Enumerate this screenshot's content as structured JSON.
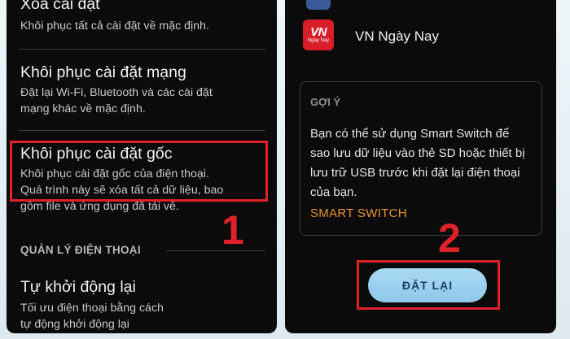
{
  "left_screen": {
    "items": [
      {
        "title": "Xóa cài đặt",
        "desc": "Khôi phục tất cả cài đặt về mặc định."
      },
      {
        "title": "Khôi phục cài đặt mạng",
        "desc_lines": [
          "Đặt lại Wi-Fi, Bluetooth và các cài đặt",
          "mạng khác về mặc định."
        ]
      },
      {
        "title": "Khôi phục cài đặt gốc",
        "desc_lines": [
          "Khôi phục cài đặt gốc của điện thoại.",
          "Quá trình này sẽ xóa tất cả dữ liệu, bao",
          "gồm file và ứng dụng đã tải về."
        ]
      },
      {
        "title": "Tự khởi động lại",
        "desc_lines": [
          "Tối ưu điện thoại bằng cách",
          "tự động khởi động lại"
        ]
      }
    ],
    "section_header": "QUẢN LÝ ĐIỆN THOẠI",
    "step_number": "1"
  },
  "right_screen": {
    "app": {
      "icon_text": "VN",
      "icon_subtext": "Ngày Nay",
      "name": "VN Ngày Nay"
    },
    "tip": {
      "label": "GỢI Ý",
      "body_lines": [
        "Bạn có thể sử dụng Smart Switch để",
        "sao lưu dữ liệu vào thẻ SD hoặc thiết bị",
        "lưu trữ USB trước khi đặt lại điện thoại",
        "của bạn."
      ],
      "link": "SMART SWITCH"
    },
    "reset_button": "ĐẶT LẠI",
    "step_number": "2"
  },
  "colors": {
    "highlight": "#e0212a",
    "link": "#e8932f",
    "button": "#a9d9f2",
    "screen_bg": "#0b0b0b"
  }
}
